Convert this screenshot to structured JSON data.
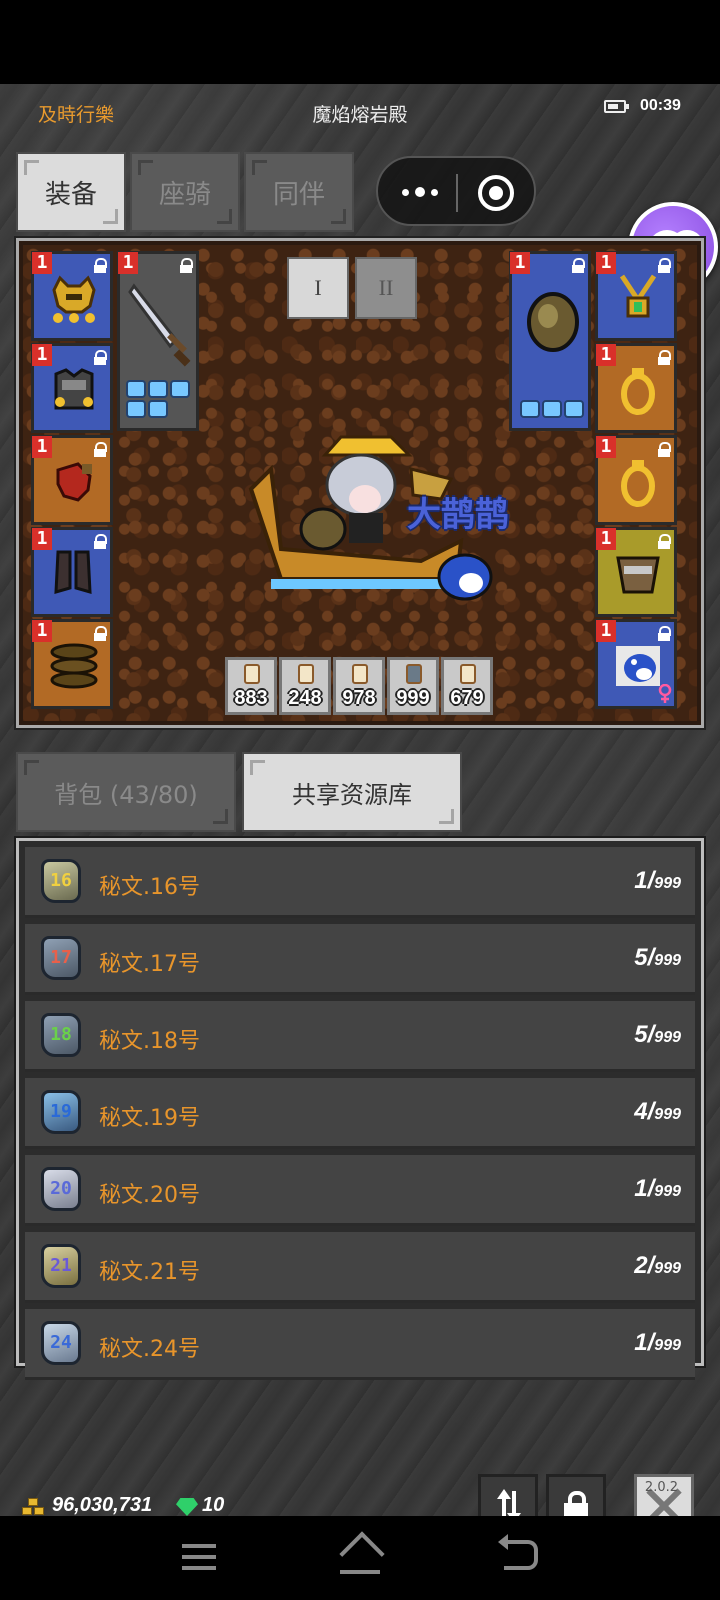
{
  "header": {
    "guild": "及時行樂",
    "map_name": "魔焰熔岩殿",
    "time": "00:39"
  },
  "main_tabs": [
    {
      "label": "装备",
      "active": true
    },
    {
      "label": "座骑",
      "active": false
    },
    {
      "label": "同伴",
      "active": false
    }
  ],
  "equipment": {
    "page_buttons": [
      "I",
      "II"
    ],
    "hero_name": "大鹊鹊",
    "slots": [
      {
        "name": "helmet",
        "level": "1"
      },
      {
        "name": "armor",
        "level": "1"
      },
      {
        "name": "gloves",
        "level": "1"
      },
      {
        "name": "boots",
        "level": "1"
      },
      {
        "name": "belt",
        "level": "1"
      },
      {
        "name": "sword",
        "level": "1"
      },
      {
        "name": "shield",
        "level": "1"
      },
      {
        "name": "necklace",
        "level": "1"
      },
      {
        "name": "ring-1",
        "level": "1"
      },
      {
        "name": "ring-2",
        "level": "1"
      },
      {
        "name": "bracer",
        "level": "1"
      },
      {
        "name": "pet",
        "level": "1"
      }
    ],
    "potions": [
      "883",
      "248",
      "978",
      "999",
      "679"
    ]
  },
  "storage_tabs": [
    {
      "label": "背包 (43/80)",
      "active": false
    },
    {
      "label": "共享资源库",
      "active": true
    }
  ],
  "items": [
    {
      "badge": "16",
      "name": "秘文.16号",
      "count": "1",
      "max": "999"
    },
    {
      "badge": "17",
      "name": "秘文.17号",
      "count": "5",
      "max": "999"
    },
    {
      "badge": "18",
      "name": "秘文.18号",
      "count": "5",
      "max": "999"
    },
    {
      "badge": "19",
      "name": "秘文.19号",
      "count": "4",
      "max": "999"
    },
    {
      "badge": "20",
      "name": "秘文.20号",
      "count": "1",
      "max": "999"
    },
    {
      "badge": "21",
      "name": "秘文.21号",
      "count": "2",
      "max": "999"
    },
    {
      "badge": "24",
      "name": "秘文.24号",
      "count": "1",
      "max": "999"
    }
  ],
  "footer": {
    "gold": "96,030,731",
    "emerald": "10",
    "version": "2.0.2"
  },
  "colors": {
    "accent_orange": "#e8952b",
    "slot_blue": "#3f59b6",
    "slot_orange": "#b26a25",
    "level_red": "#d9302a"
  }
}
